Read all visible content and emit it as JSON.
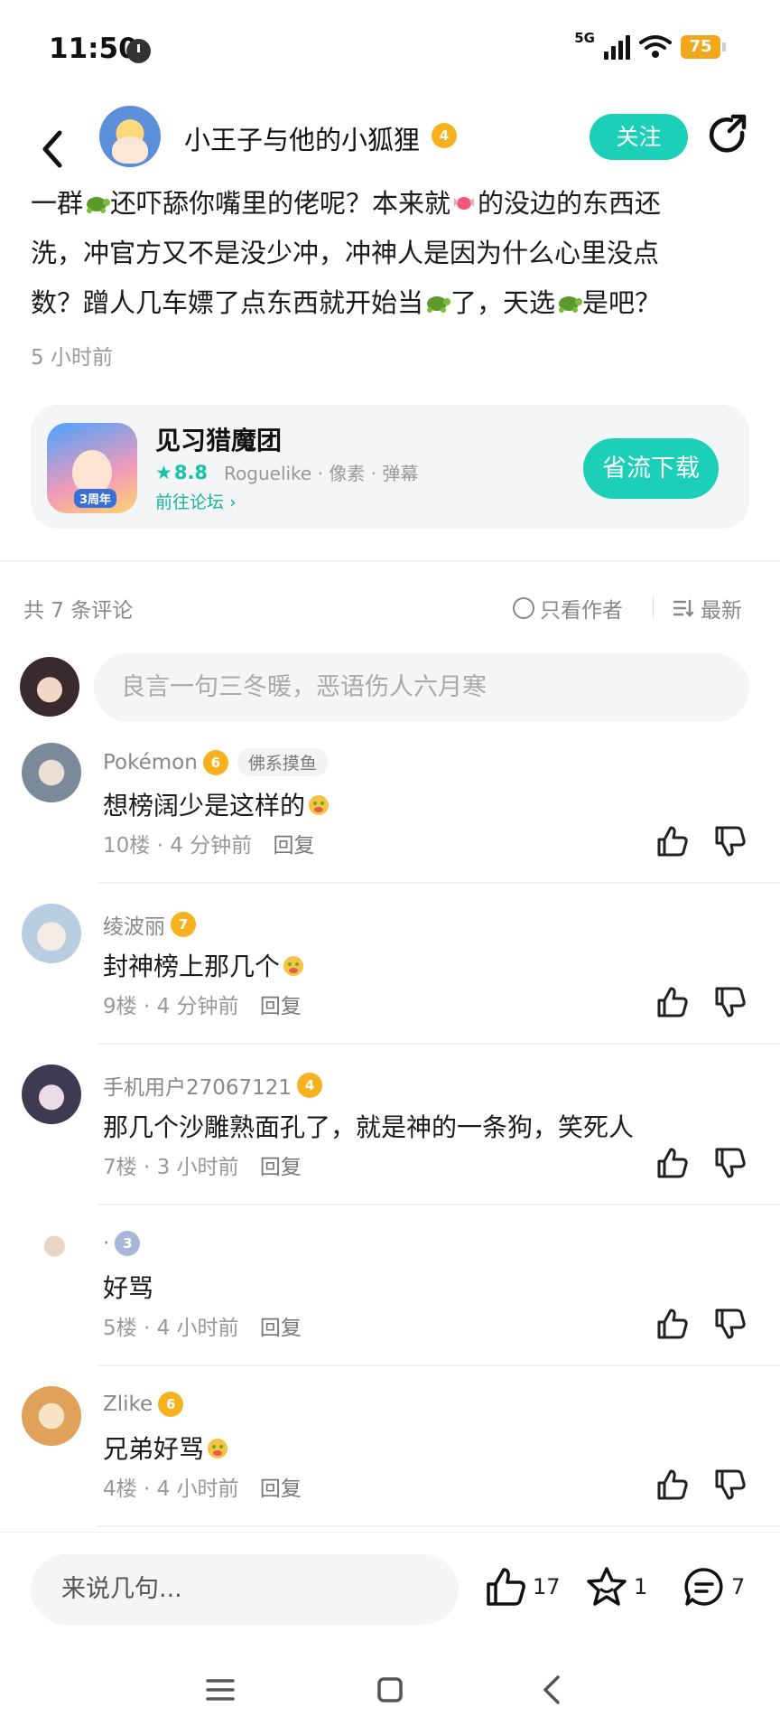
{
  "status_bar": {
    "time": "11:50",
    "network": "5G",
    "battery": "75"
  },
  "header": {
    "author_name": "小王子与他的小狐狸",
    "author_level": "4",
    "follow_label": "关注"
  },
  "post": {
    "lines": [
      [
        "一群",
        "🐢",
        "还吓舔你嘴里的佬呢？本来就",
        "🍬",
        "的没边的东西还"
      ],
      [
        "洗，冲官方又不是没少冲，冲神人是因为什么心里没点"
      ],
      [
        "数？蹭人几车嫖了点东西就开始当",
        "🐢",
        "了，天选",
        "🐢",
        "是吧？"
      ]
    ],
    "time": "5 小时前"
  },
  "game_card": {
    "icon_tag": "3周年",
    "name": "见习猎魔团",
    "rating": "8.8",
    "tags": "Roguelike · 像素 · 弹幕",
    "forum_link": "前往论坛",
    "download_label": "省流下载"
  },
  "comments_section": {
    "count_label": "共 7 条评论",
    "only_author_label": "只看作者",
    "sort_label": "最新",
    "input_placeholder": "良言一句三冬暖，恶语伤人六月寒"
  },
  "comments": [
    {
      "user": "Pokémon",
      "level": "6",
      "tag": "佛系摸鱼",
      "text": "想榜阔少是这样的",
      "emoji": true,
      "floor": "10楼",
      "time": "4 分钟前",
      "reply": "回复",
      "avatar_color": "#7a8a9a"
    },
    {
      "user": "绫波丽",
      "level": "7",
      "tag": "",
      "text": "封神榜上那几个",
      "emoji": true,
      "floor": "9楼",
      "time": "4 分钟前",
      "reply": "回复",
      "avatar_color": "#b8cde0"
    },
    {
      "user": "手机用户27067121",
      "level": "4",
      "tag": "",
      "text": "那几个沙雕熟面孔了，就是神的一条狗，笑死人",
      "emoji": false,
      "floor": "7楼",
      "time": "3 小时前",
      "reply": "回复",
      "avatar_color": "#3e3a52"
    },
    {
      "user": "·",
      "level": "3",
      "tag": "",
      "text": "好骂",
      "emoji": false,
      "floor": "5楼",
      "time": "4 小时前",
      "reply": "回复",
      "avatar_color": "#6b6f5a"
    },
    {
      "user": "Zlike",
      "level": "6",
      "tag": "",
      "text": "兄弟好骂",
      "emoji": true,
      "floor": "4楼",
      "time": "4 小时前",
      "reply": "回复",
      "avatar_color": "#e0a25a"
    }
  ],
  "bottom_bar": {
    "input_placeholder": "来说几句...",
    "likes": "17",
    "favorites": "1",
    "comments": "7"
  },
  "colors": {
    "accent": "#1ccfb7",
    "level_badge": "#f5b21e",
    "battery": "#f2a71b"
  }
}
